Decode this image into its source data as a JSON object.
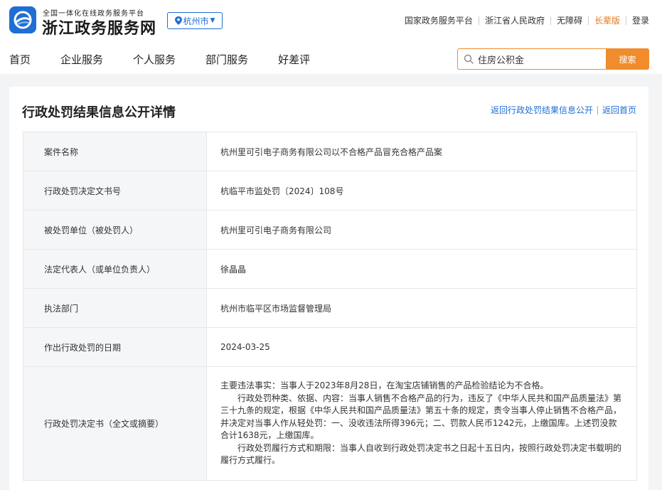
{
  "header": {
    "logo_subtitle": "全国一体化在线政务服务平台",
    "logo_title": "浙江政务服务网",
    "city": "杭州市",
    "top_links": [
      "国家政务服务平台",
      "浙江省人民政府",
      "无障碍",
      "长辈版",
      "登录"
    ]
  },
  "nav": {
    "items": [
      "首页",
      "企业服务",
      "个人服务",
      "部门服务",
      "好差评"
    ]
  },
  "search": {
    "value": "住房公积金",
    "button": "搜索"
  },
  "page": {
    "title": "行政处罚结果信息公开详情",
    "back_list": "返回行政处罚结果信息公开",
    "back_home": "返回首页"
  },
  "details": [
    {
      "label": "案件名称",
      "value": "杭州里可引电子商务有限公司以不合格产品冒充合格产品案"
    },
    {
      "label": "行政处罚决定文书号",
      "value": "杭临平市监处罚〔2024〕108号"
    },
    {
      "label": "被处罚单位（被处罚人）",
      "value": "杭州里可引电子商务有限公司"
    },
    {
      "label": "法定代表人（或单位负责人）",
      "value": "徐晶晶"
    },
    {
      "label": "执法部门",
      "value": "杭州市临平区市场监督管理局"
    },
    {
      "label": "作出行政处罚的日期",
      "value": "2024-03-25"
    },
    {
      "label": "行政处罚决定书（全文或摘要）",
      "paragraphs": [
        "主要违法事实：当事人于2023年8月28日，在淘宝店铺销售的产品检验结论为不合格。",
        "行政处罚种类、依据、内容：当事人销售不合格产品的行为，违反了《中华人民共和国产品质量法》第三十九条的规定，根据《中华人民共和国产品质量法》第五十条的规定，责令当事人停止销售不合格产品，并决定对当事人作从轻处罚：一、没收违法所得396元；二、罚款人民币1242元，上缴国库。上述罚没款合计1638元，上缴国库。",
        "行政处罚履行方式和期限：当事人自收到行政处罚决定书之日起十五日内，按照行政处罚决定书载明的履行方式履行。"
      ]
    }
  ]
}
